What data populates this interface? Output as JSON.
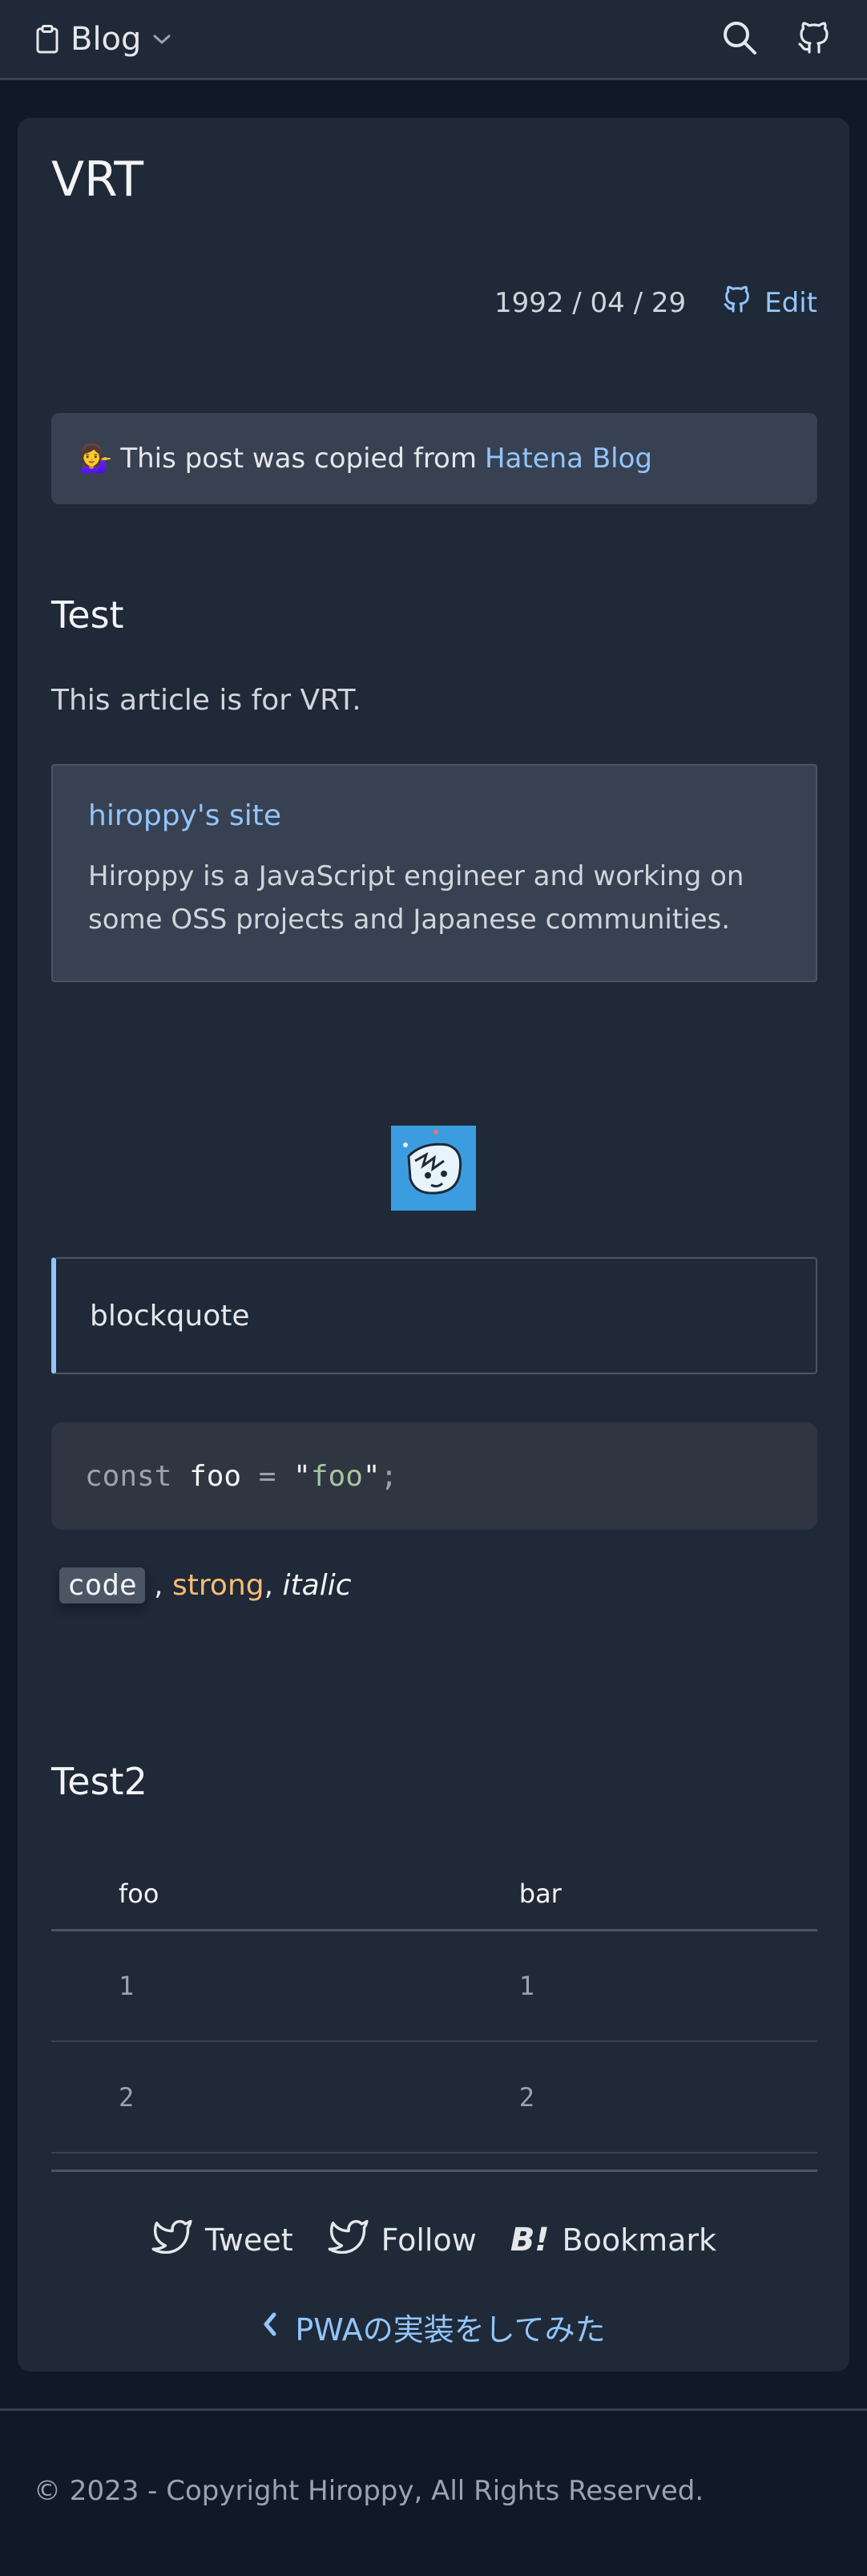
{
  "header": {
    "brand_label": "Blog",
    "brand_icon": "clipboard-icon",
    "dropdown_icon": "chevron-down-icon",
    "search_icon": "search-icon",
    "github_icon": "github-icon"
  },
  "post": {
    "title": "VRT",
    "date": "1992 / 04 / 29",
    "edit_label": "Edit",
    "notice": {
      "emoji": "💁‍♀️",
      "text": "This post was copied from",
      "link_label": "Hatena Blog"
    },
    "section1_heading": "Test",
    "paragraph": "This article is for VRT.",
    "embed": {
      "title": "hiroppy's site",
      "description": "Hiroppy is a JavaScript engineer and working on some OSS projects and Japanese communities."
    },
    "blockquote": "blockquote",
    "code": {
      "keyword": "const",
      "identifier": "foo",
      "operator": "=",
      "string": "\"foo\"",
      "semicolon": ";"
    },
    "inline": {
      "code": "code",
      "sep1": " , ",
      "strong": "strong",
      "sep2": ", ",
      "italic": "italic"
    },
    "section2_heading": "Test2",
    "table": {
      "headers": [
        "foo",
        "bar"
      ],
      "rows": [
        [
          "1",
          "1"
        ],
        [
          "2",
          "2"
        ]
      ]
    }
  },
  "share": {
    "tweet_label": "Tweet",
    "follow_label": "Follow",
    "bookmark_label": "Bookmark",
    "bookmark_glyph": "B!"
  },
  "prev_link_label": "PWAの実装をしてみた",
  "footer": {
    "copyright": "© 2023 - Copyright Hiroppy, All Rights Reserved."
  },
  "colors": {
    "background": "#111827",
    "surface": "#1f2937",
    "link": "#93c5fd",
    "strong": "#fdba74",
    "avatar_bg": "#3b9de0"
  }
}
